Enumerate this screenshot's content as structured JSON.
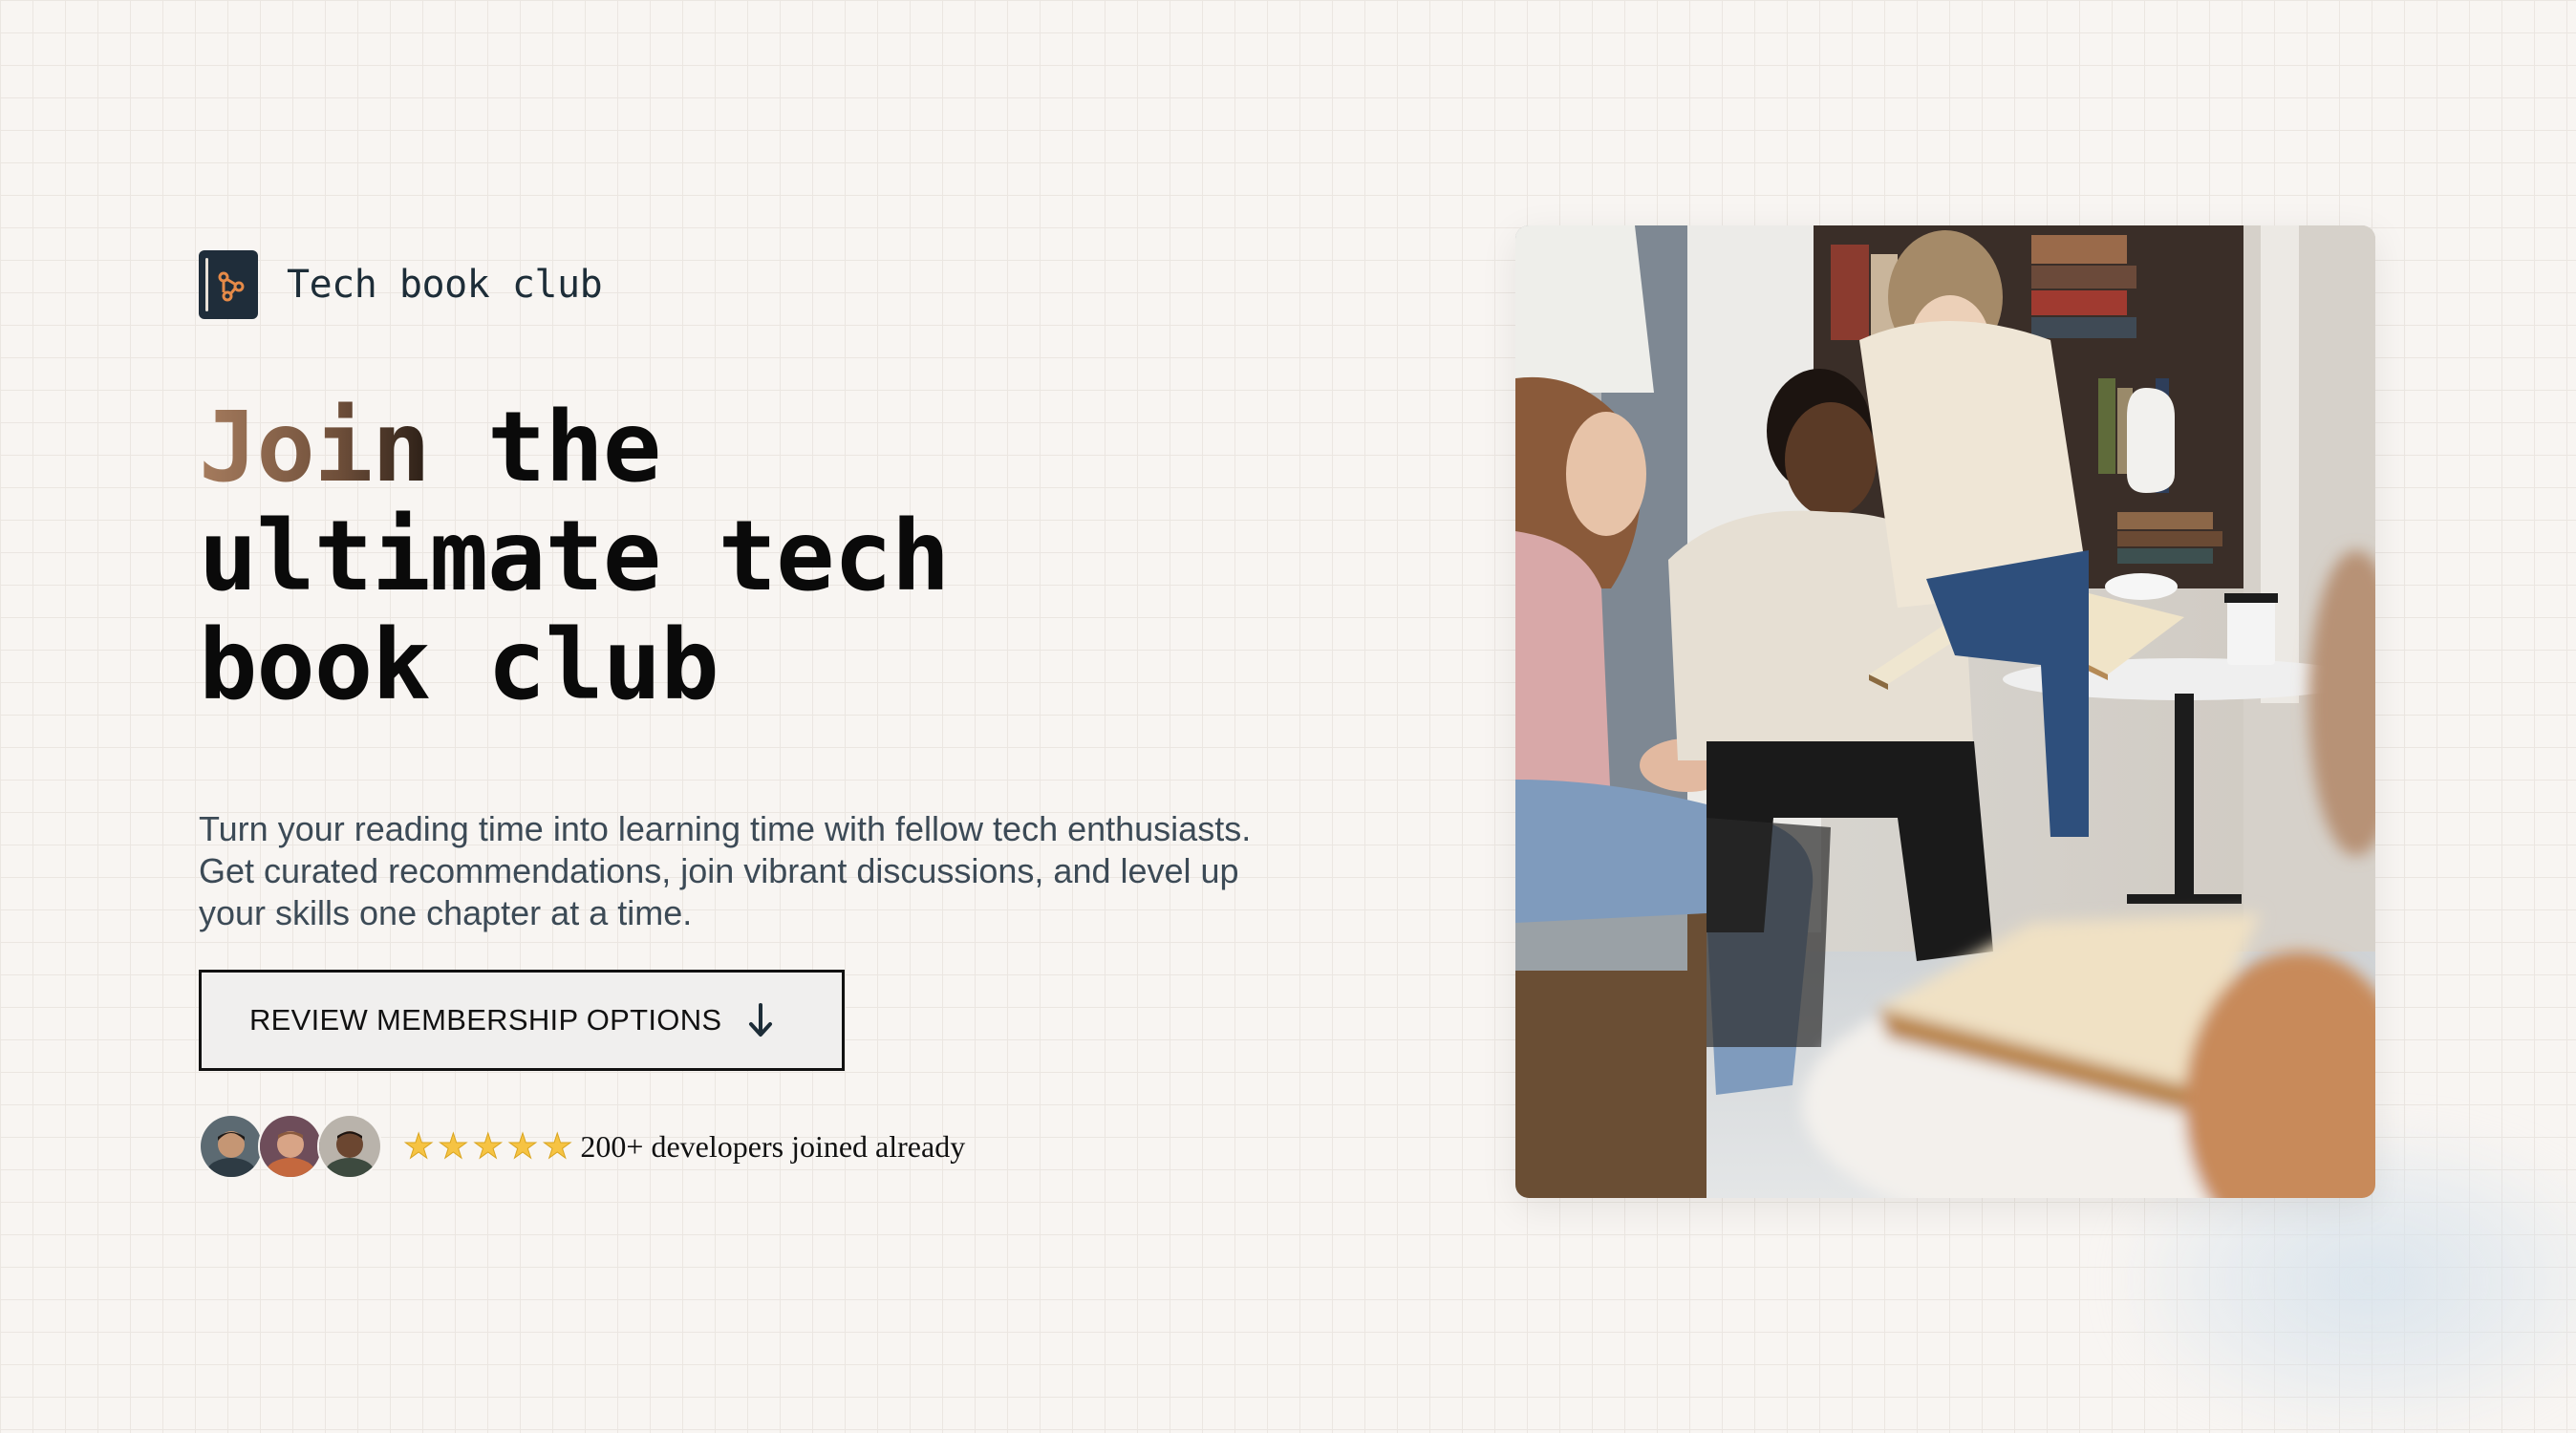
{
  "brand": {
    "name": "Tech book club",
    "logo_icon": "book-branch-icon"
  },
  "hero": {
    "headline_lead": "Join",
    "headline_rest": " the",
    "headline_line2": "ultimate tech",
    "headline_line3": "book club",
    "description": "Turn your reading time into learning time with fellow tech enthusiasts. Get curated recommendations, join vibrant discussions, and level up your skills one chapter at a time.",
    "cta_label": "REVIEW MEMBERSHIP OPTIONS",
    "cta_icon": "arrow-down-icon"
  },
  "social_proof": {
    "avatars": [
      "member-avatar-1",
      "member-avatar-2",
      "member-avatar-3"
    ],
    "rating_stars": 5,
    "text": "200+ developers joined already"
  },
  "image": {
    "subject": "readers-group-photo"
  },
  "colors": {
    "background": "#f8f5f2",
    "grid": "#ebe6e1",
    "logo_bg": "#1f2d3a",
    "logo_accent": "#e58a48",
    "headline_gradient_start": "#a67c5e",
    "text_body": "#3c4a56",
    "star": "#f6c343"
  }
}
